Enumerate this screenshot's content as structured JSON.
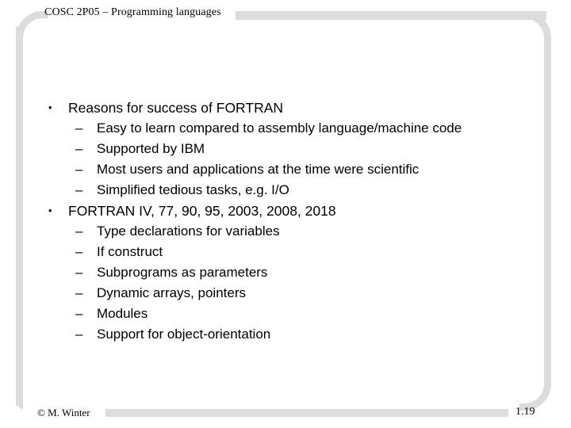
{
  "slide": {
    "header": {
      "title": "COSC 2P05 – Programming languages"
    },
    "content": [
      {
        "level": 1,
        "marker": "•",
        "text": "Reasons for success of FORTRAN"
      },
      {
        "level": 2,
        "marker": "–",
        "text": "Easy to learn compared to assembly language/machine code"
      },
      {
        "level": 2,
        "marker": "–",
        "text": "Supported by IBM"
      },
      {
        "level": 2,
        "marker": "–",
        "text": "Most users and applications at the time were scientific"
      },
      {
        "level": 2,
        "marker": "–",
        "text": "Simplified tedious tasks, e.g. I/O"
      },
      {
        "level": 1,
        "marker": "•",
        "text": "FORTRAN IV, 77, 90, 95, 2003, 2008, 2018"
      },
      {
        "level": 2,
        "marker": "–",
        "text": "Type declarations for variables"
      },
      {
        "level": 2,
        "marker": "–",
        "text": "If construct"
      },
      {
        "level": 2,
        "marker": "–",
        "text": "Subprograms as parameters"
      },
      {
        "level": 2,
        "marker": "–",
        "text": "Dynamic arrays, pointers"
      },
      {
        "level": 2,
        "marker": "–",
        "text": "Modules"
      },
      {
        "level": 2,
        "marker": "–",
        "text": "Support for object-orientation"
      }
    ],
    "footer": {
      "copyright": "© M. Winter",
      "page_number": "1.19"
    },
    "colors": {
      "frame_gray": "#dcdcdc",
      "text": "#000000",
      "background": "#ffffff"
    }
  }
}
